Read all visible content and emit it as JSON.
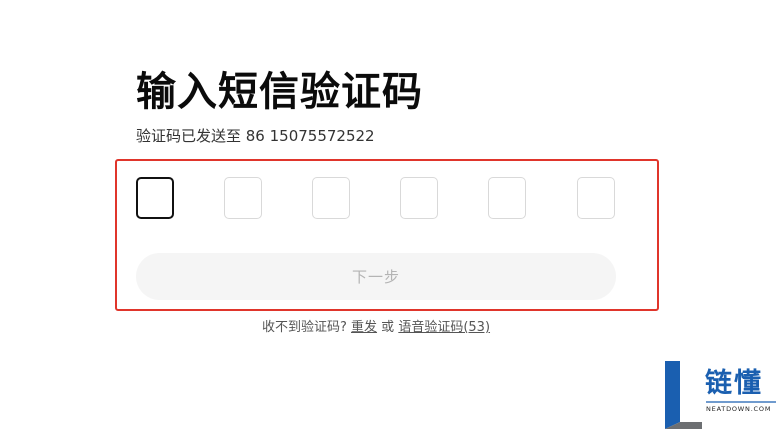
{
  "header": {
    "title": "输入短信验证码",
    "subtitle": "验证码已发送至 86 15075572522"
  },
  "code_inputs": {
    "count": 6,
    "values": [
      "",
      "",
      "",
      "",
      "",
      ""
    ],
    "active_index": 0
  },
  "next_button": {
    "label": "下一步",
    "enabled": false
  },
  "resend": {
    "prompt": "收不到验证码?",
    "resend_label": "重发",
    "or_text": "或",
    "voice_label": "语音验证码(53)"
  },
  "watermark": {
    "name": "链懂",
    "domain": "NEATDOWN.COM",
    "colors": {
      "blue": "#1a5fb0",
      "gray": "#6d6f72"
    }
  },
  "colors": {
    "highlight_border": "#e0352b",
    "button_bg": "#f5f5f5",
    "button_text": "#b4b4b4"
  }
}
